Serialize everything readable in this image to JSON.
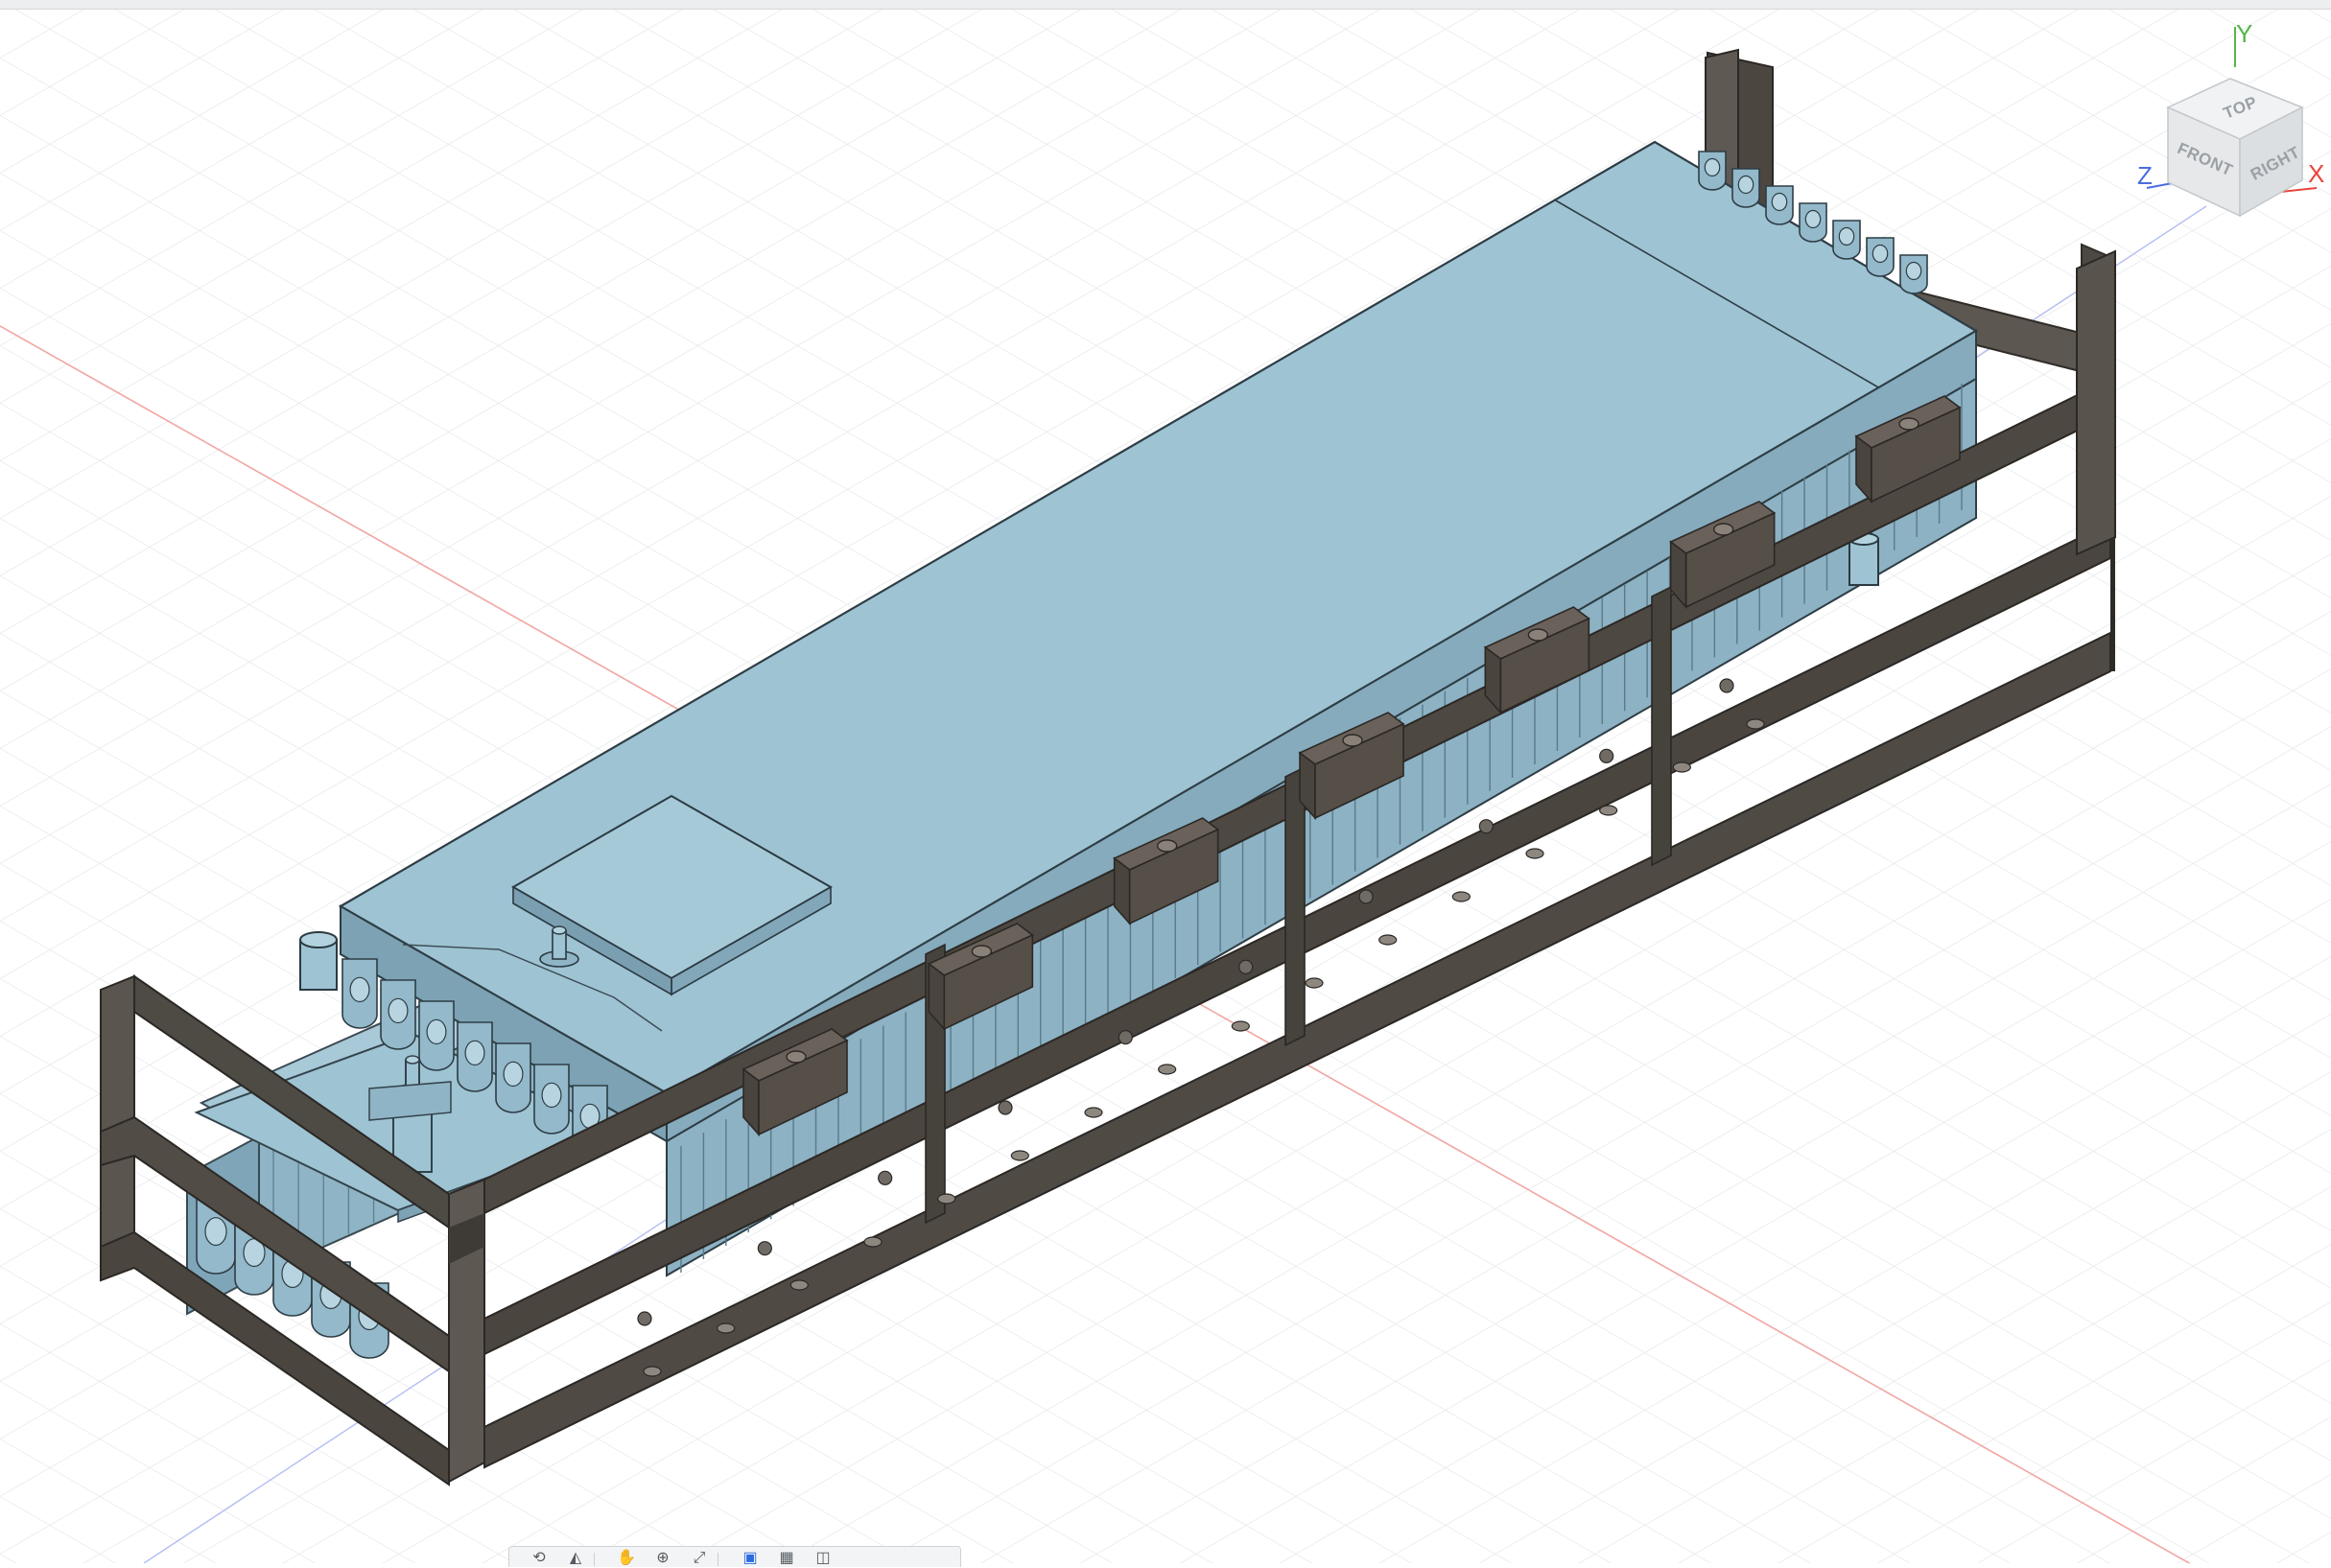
{
  "viewcube": {
    "faces": {
      "top": "TOP",
      "front": "FRONT",
      "right": "RIGHT"
    },
    "axes": {
      "x": "X",
      "y": "Y",
      "z": "Z"
    },
    "colors": {
      "x": "#e8453c",
      "y": "#55b64a",
      "z": "#4a6ee0"
    }
  },
  "model": {
    "body_color": "#9ec3d3",
    "frame_color": "#4a4640",
    "bracket_color": "#57504a",
    "grid_color": "#e6e8ea"
  },
  "navigation_toolbar": {
    "tools": [
      {
        "name": "orbit-tool",
        "icon": "orbit-icon",
        "glyph": "⟲"
      },
      {
        "name": "look-at-tool",
        "icon": "look-at-icon",
        "glyph": "◭"
      },
      {
        "name": "pan-tool",
        "icon": "hand-icon",
        "glyph": "✋"
      },
      {
        "name": "zoom-tool",
        "icon": "zoom-icon",
        "glyph": "⊕"
      },
      {
        "name": "fit-tool",
        "icon": "fit-icon",
        "glyph": "⤢"
      },
      {
        "name": "display-settings-tool",
        "icon": "display-icon",
        "glyph": "▣"
      },
      {
        "name": "grid-settings-tool",
        "icon": "grid-icon",
        "glyph": "▦"
      },
      {
        "name": "viewports-tool",
        "icon": "viewports-icon",
        "glyph": "◫"
      }
    ]
  }
}
